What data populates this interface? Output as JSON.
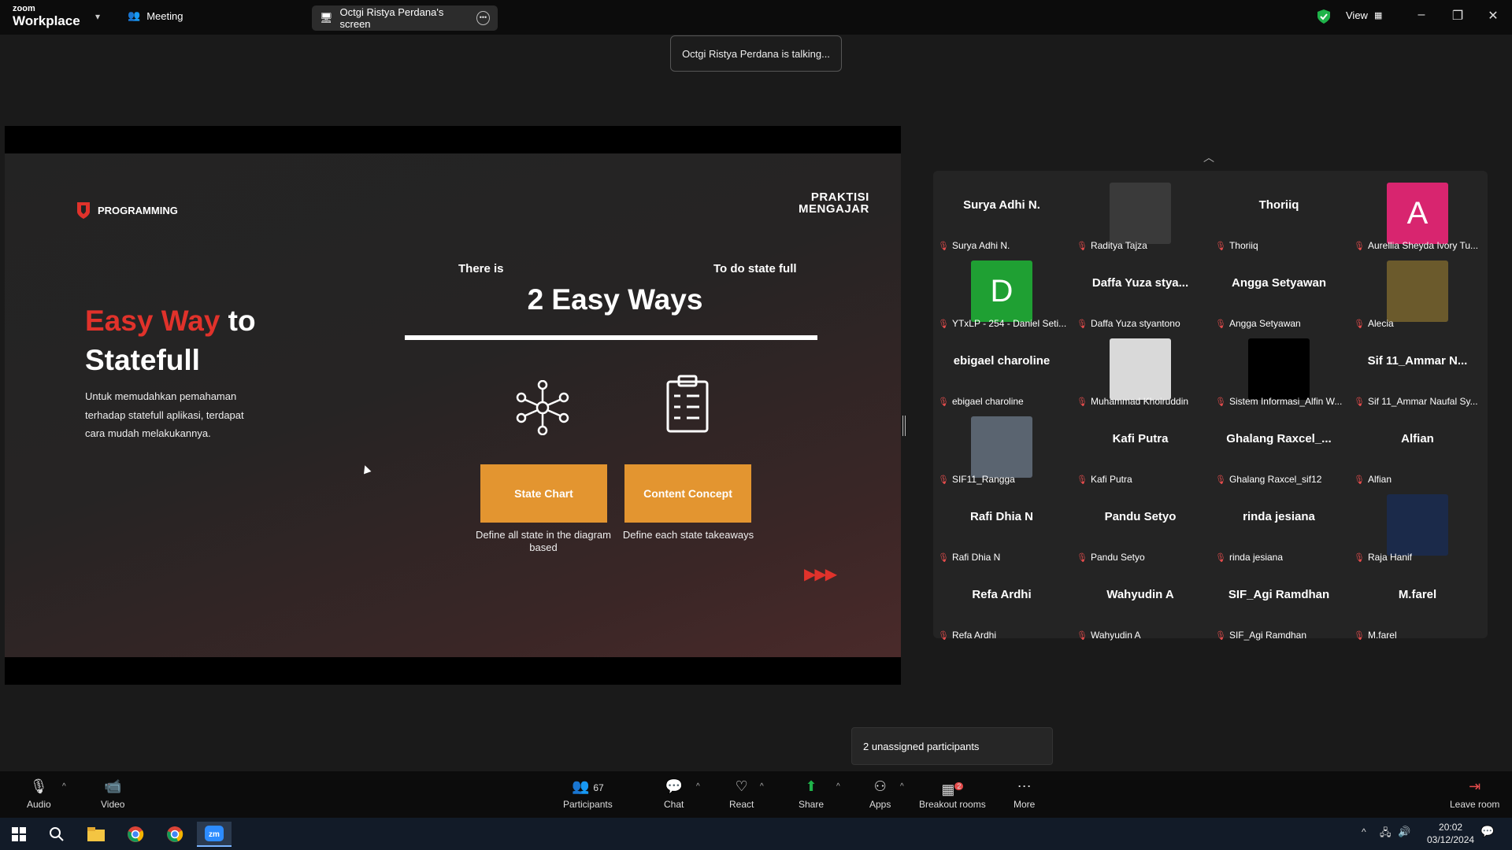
{
  "app": {
    "brand_top": "zoom",
    "brand_bottom": "Workplace",
    "meeting_label": "Meeting",
    "screen_tab": "Octgi Ristya Perdana's screen",
    "view_label": "View"
  },
  "talking": "Octgi Ristya Perdana is talking...",
  "slide": {
    "section": "PROGRAMMING",
    "logo_line1": "PRAKTISI",
    "logo_line2": "MENGAJAR",
    "title_red": "Easy Way",
    "title_rest1": " to",
    "title_line2": "Statefull",
    "description": "Untuk memudahkan pemahaman terhadap statefull aplikasi, terdapat cara mudah melakukannya.",
    "there_is": "There is",
    "to_do": "To do state full",
    "headline": "2 Easy Ways",
    "option1": {
      "label": "State Chart",
      "caption": "Define all state in the diagram based"
    },
    "option2": {
      "label": "Content Concept",
      "caption": "Define each state takeaways"
    },
    "arrows": "▶▶▶"
  },
  "participants": [
    {
      "big": "Surya Adhi N.",
      "label": "Surya Adhi N."
    },
    {
      "avatar": "photo",
      "color": "#3a3a3a",
      "label": "Raditya Tajza"
    },
    {
      "big": "Thoriiq",
      "label": "Thoriiq"
    },
    {
      "avatar": "A",
      "color": "#d8256f",
      "label": "Aurellia Sheyda Ivory Tu..."
    },
    {
      "avatar": "D",
      "color": "#1fa033",
      "label": "YTxLP - 254 - Daniel Seti..."
    },
    {
      "big": "Daffa Yuza stya...",
      "label": "Daffa Yuza styantono"
    },
    {
      "big": "Angga Setyawan",
      "label": "Angga Setyawan"
    },
    {
      "avatar": "photo",
      "color": "#6b5a2c",
      "label": "Alecia"
    },
    {
      "big": "ebigael charoline",
      "label": "ebigael charoline"
    },
    {
      "avatar": "photo",
      "color": "#d9d9d9",
      "label": "Muhammad Khoiruddin"
    },
    {
      "avatar": "photo",
      "color": "#000000",
      "label": "Sistem Informasi_Alfin W..."
    },
    {
      "big": "Sif 11_Ammar N...",
      "label": "Sif 11_Ammar Naufal Sy..."
    },
    {
      "avatar": "photo",
      "color": "#5a6470",
      "label": "SIF11_Rangga"
    },
    {
      "big": "Kafi Putra",
      "label": "Kafi Putra"
    },
    {
      "big": "Ghalang  Raxcel_...",
      "label": "Ghalang Raxcel_sif12"
    },
    {
      "big": "Alfian",
      "label": "Alfian"
    },
    {
      "big": "Rafi Dhia N",
      "label": "Rafi Dhia N"
    },
    {
      "big": "Pandu Setyo",
      "label": "Pandu Setyo"
    },
    {
      "big": "rinda jesiana",
      "label": "rinda jesiana"
    },
    {
      "avatar": "photo",
      "color": "#1b2a4a",
      "label": "Raja Hanif"
    },
    {
      "big": "Refa Ardhi",
      "label": "Refa Ardhi"
    },
    {
      "big": "Wahyudin A",
      "label": "Wahyudin A"
    },
    {
      "big": "SIF_Agi Ramdhan",
      "label": "SIF_Agi Ramdhan"
    },
    {
      "big": "M.farel",
      "label": "M.farel"
    }
  ],
  "unassigned": "2 unassigned participants",
  "toolbar": {
    "audio": "Audio",
    "video": "Video",
    "participants": "Participants",
    "participants_count": "67",
    "chat": "Chat",
    "react": "React",
    "share": "Share",
    "apps": "Apps",
    "breakout": "Breakout rooms",
    "breakout_badge": "2",
    "more": "More",
    "leave": "Leave room"
  },
  "clock": {
    "time": "20:02",
    "date": "03/12/2024"
  }
}
